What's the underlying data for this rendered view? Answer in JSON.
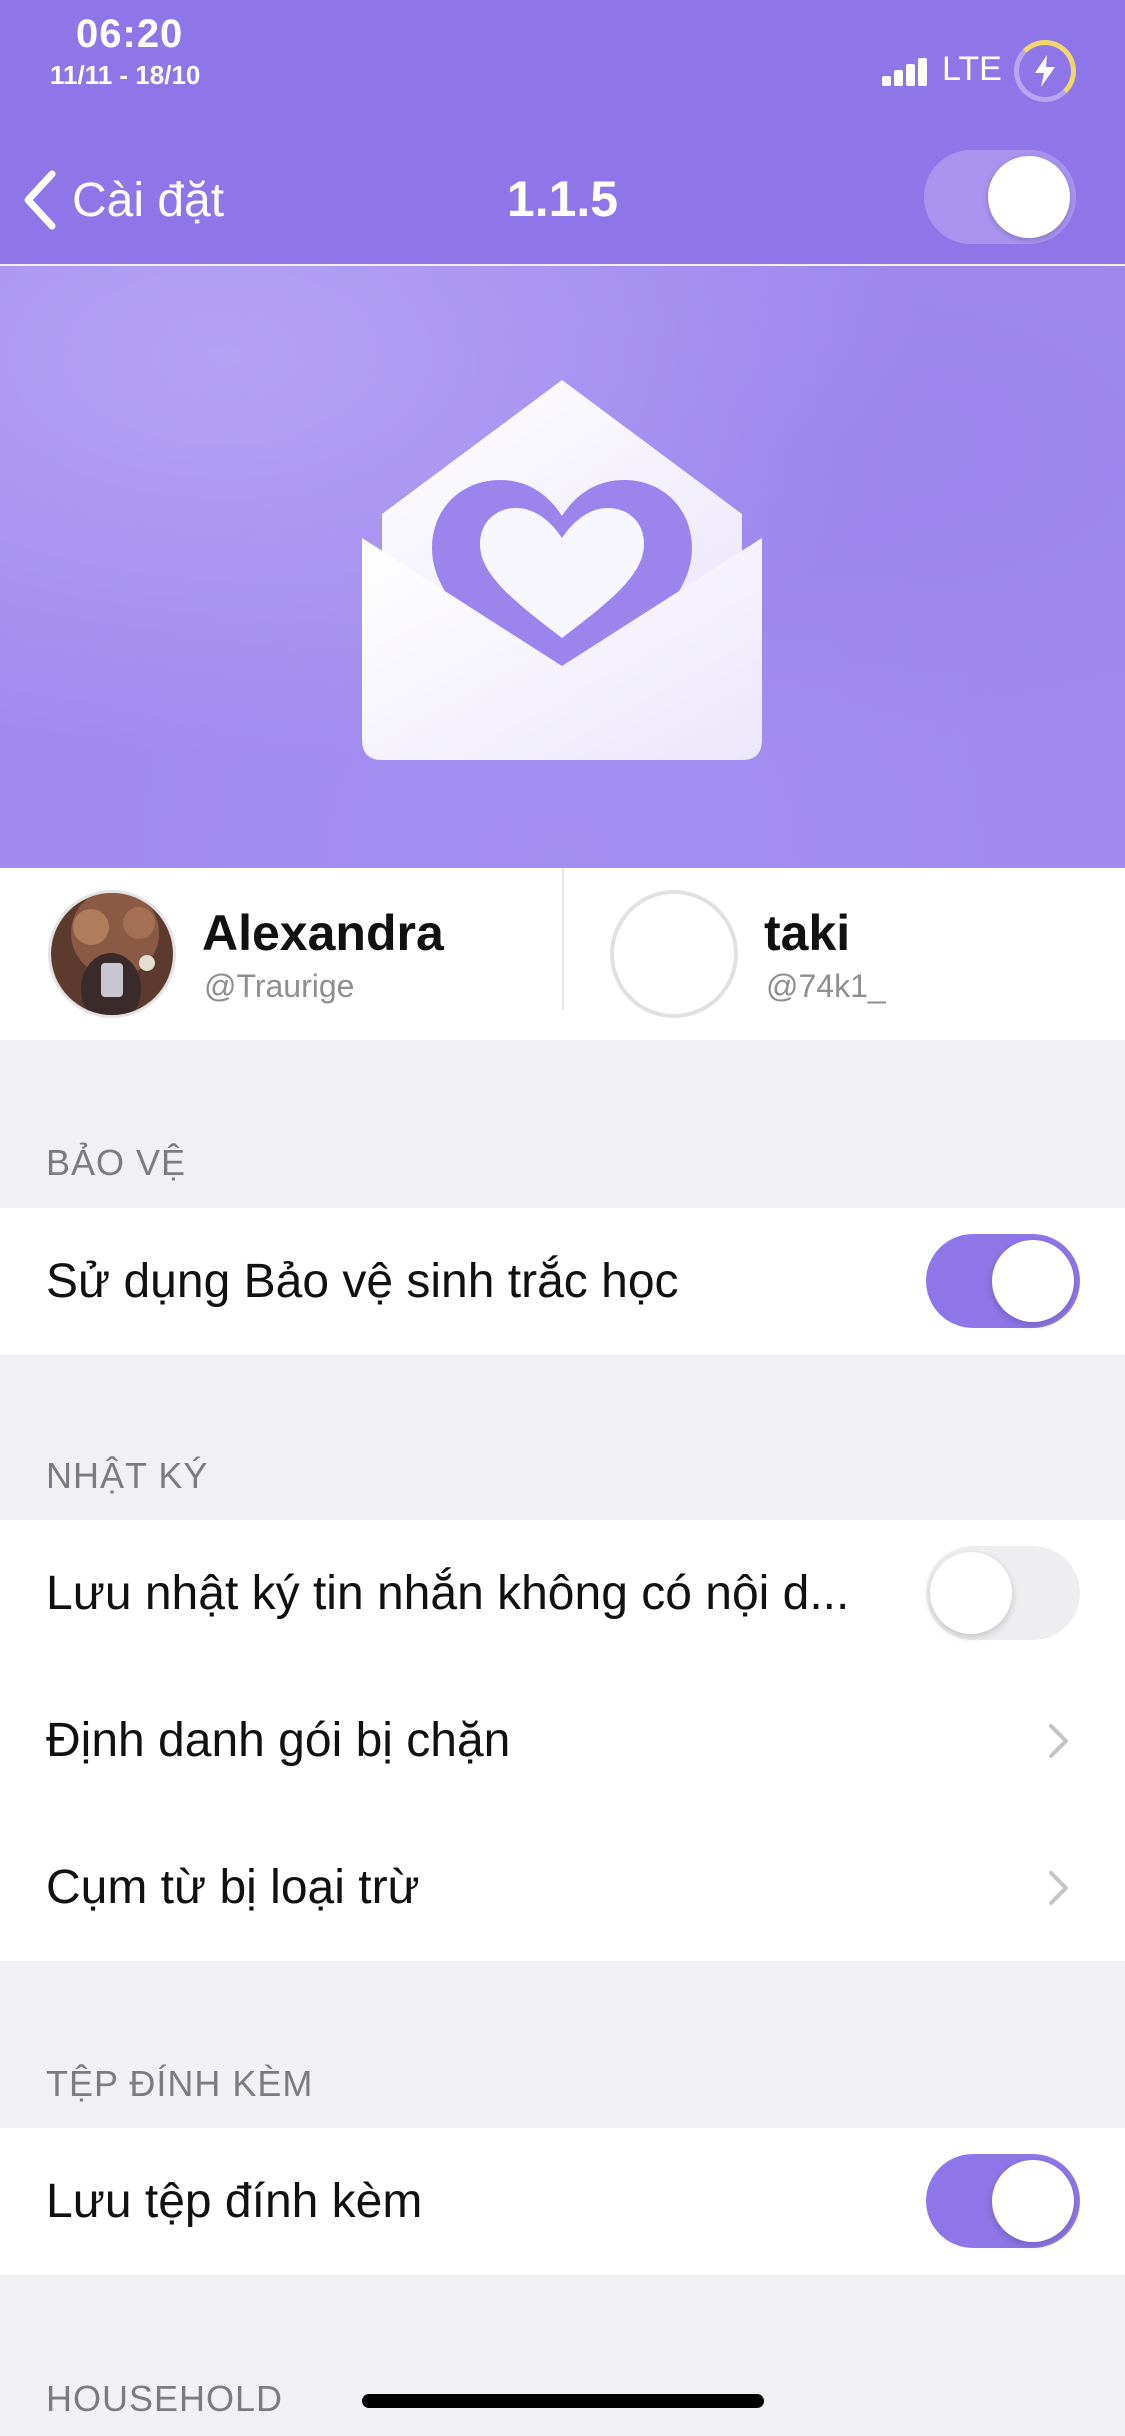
{
  "status_bar": {
    "time": "06:20",
    "date": "11/11 - 18/10",
    "network": "LTE",
    "icons": [
      "signal-icon",
      "battery-charging-icon"
    ]
  },
  "nav": {
    "back_label": "Cài đặt",
    "title": "1.1.5",
    "header_toggle_on": true
  },
  "hero": {
    "icon": "envelope-heart-icon"
  },
  "profiles": [
    {
      "name": "Alexandra",
      "handle": "@Traurige"
    },
    {
      "name": "taki",
      "handle": "@74k1_"
    }
  ],
  "sections": {
    "protection": {
      "header": "BẢO VỆ",
      "rows": [
        {
          "label": "Sử dụng Bảo vệ sinh trắc học",
          "control": "toggle",
          "on": true
        }
      ]
    },
    "log": {
      "header": "NHẬT KÝ",
      "rows": [
        {
          "label": "Lưu nhật ký tin nhắn không có nội d...",
          "control": "toggle",
          "on": false
        },
        {
          "label": "Định danh gói bị chặn",
          "control": "chevron"
        },
        {
          "label": "Cụm từ bị loại trừ",
          "control": "chevron"
        }
      ]
    },
    "attachments": {
      "header": "TỆP ĐÍNH KÈM",
      "rows": [
        {
          "label": "Lưu tệp đính kèm",
          "control": "toggle",
          "on": true
        }
      ]
    },
    "household": {
      "header": "HOUSEHOLD"
    }
  },
  "colors": {
    "accent": "#8f76e8",
    "background": "#f1f0f5"
  }
}
